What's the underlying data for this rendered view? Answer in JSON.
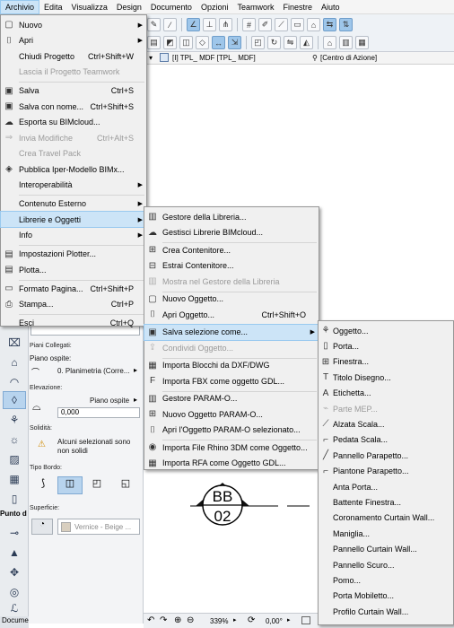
{
  "menubar": [
    "Archivio",
    "Edita",
    "Visualizza",
    "Design",
    "Documento",
    "Opzioni",
    "Teamwork",
    "Finestre",
    "Aiuto"
  ],
  "tabs": {
    "view": "[I] TPL_ MDF [TPL_ MDF]",
    "anchor": "[Centro di Azione]"
  },
  "file_menu": [
    {
      "label": "Nuovo",
      "shortcut": "",
      "submenu": true,
      "icon": "new-file-icon",
      "enabled": true
    },
    {
      "label": "Apri",
      "shortcut": "",
      "submenu": true,
      "icon": "open-folder-icon",
      "enabled": true
    },
    {
      "label": "Chiudi Progetto",
      "shortcut": "Ctrl+Shift+W",
      "submenu": false,
      "icon": "",
      "enabled": true
    },
    {
      "label": "Lascia il Progetto Teamwork",
      "shortcut": "",
      "submenu": false,
      "icon": "",
      "enabled": false
    },
    {
      "sep": true
    },
    {
      "label": "Salva",
      "shortcut": "Ctrl+S",
      "submenu": false,
      "icon": "save-icon",
      "enabled": true
    },
    {
      "label": "Salva con nome...",
      "shortcut": "Ctrl+Shift+S",
      "submenu": false,
      "icon": "save-as-icon",
      "enabled": true
    },
    {
      "label": "Esporta su BIMcloud...",
      "shortcut": "",
      "submenu": false,
      "icon": "cloud-export-icon",
      "enabled": true
    },
    {
      "label": "Invia Modifiche",
      "shortcut": "Ctrl+Alt+S",
      "submenu": false,
      "icon": "send-changes-icon",
      "enabled": false
    },
    {
      "label": "Crea Travel Pack",
      "shortcut": "",
      "submenu": false,
      "icon": "",
      "enabled": false
    },
    {
      "label": "Pubblica Iper-Modello BIMx...",
      "shortcut": "",
      "submenu": false,
      "icon": "bimx-icon",
      "enabled": true
    },
    {
      "label": "Interoperabilità",
      "shortcut": "",
      "submenu": true,
      "icon": "",
      "enabled": true
    },
    {
      "sep": true
    },
    {
      "label": "Contenuto Esterno",
      "shortcut": "",
      "submenu": true,
      "icon": "",
      "enabled": true
    },
    {
      "label": "Librerie e Oggetti",
      "shortcut": "",
      "submenu": true,
      "icon": "",
      "enabled": true,
      "active": true
    },
    {
      "label": "Info",
      "shortcut": "",
      "submenu": true,
      "icon": "",
      "enabled": true
    },
    {
      "sep": true
    },
    {
      "label": "Impostazioni Plotter...",
      "shortcut": "",
      "submenu": false,
      "icon": "plotter-setup-icon",
      "enabled": true
    },
    {
      "label": "Plotta...",
      "shortcut": "",
      "submenu": false,
      "icon": "plotter-icon",
      "enabled": true
    },
    {
      "sep": true
    },
    {
      "label": "Formato Pagina...",
      "shortcut": "Ctrl+Shift+P",
      "submenu": false,
      "icon": "page-setup-icon",
      "enabled": true
    },
    {
      "label": "Stampa...",
      "shortcut": "Ctrl+P",
      "submenu": false,
      "icon": "printer-icon",
      "enabled": true
    },
    {
      "sep": true
    },
    {
      "label": "Esci",
      "shortcut": "Ctrl+Q",
      "submenu": false,
      "icon": "",
      "enabled": true
    }
  ],
  "library_menu": [
    {
      "label": "Gestore della Libreria...",
      "shortcut": "",
      "icon": "library-manager-icon",
      "enabled": true
    },
    {
      "label": "Gestisci Librerie BIMcloud...",
      "shortcut": "",
      "icon": "bimcloud-library-icon",
      "enabled": true
    },
    {
      "sep": true
    },
    {
      "label": "Crea Contenitore...",
      "shortcut": "",
      "icon": "create-container-icon",
      "enabled": true
    },
    {
      "label": "Estrai Contenitore...",
      "shortcut": "",
      "icon": "extract-container-icon",
      "enabled": true
    },
    {
      "label": "Mostra nel Gestore della Libreria",
      "shortcut": "",
      "icon": "show-in-library-icon",
      "enabled": false
    },
    {
      "sep": true
    },
    {
      "label": "Nuovo Oggetto...",
      "shortcut": "",
      "icon": "new-object-icon",
      "enabled": true
    },
    {
      "label": "Apri Oggetto...",
      "shortcut": "Ctrl+Shift+O",
      "icon": "open-object-icon",
      "enabled": true
    },
    {
      "sep": true
    },
    {
      "label": "Salva selezione come...",
      "shortcut": "",
      "icon": "save-selection-icon",
      "enabled": true,
      "active": true,
      "submenu": true
    },
    {
      "label": "Condividi Oggetto...",
      "shortcut": "",
      "icon": "share-object-icon",
      "enabled": false
    },
    {
      "sep": true
    },
    {
      "label": "Importa Blocchi da DXF/DWG",
      "shortcut": "",
      "icon": "import-dxf-icon",
      "enabled": true
    },
    {
      "label": "Importa FBX come oggetto GDL...",
      "shortcut": "",
      "icon": "import-fbx-icon",
      "enabled": true
    },
    {
      "sep": true
    },
    {
      "label": "Gestore PARAM-O...",
      "shortcut": "",
      "icon": "param-o-manager-icon",
      "enabled": true
    },
    {
      "label": "Nuovo Oggetto PARAM-O...",
      "shortcut": "",
      "icon": "new-param-o-icon",
      "enabled": true
    },
    {
      "label": "Apri l'Oggetto PARAM-O selezionato...",
      "shortcut": "",
      "icon": "open-param-o-icon",
      "enabled": true
    },
    {
      "sep": true
    },
    {
      "label": "Importa File Rhino 3DM come Oggetto...",
      "shortcut": "",
      "icon": "import-rhino-icon",
      "enabled": true
    },
    {
      "label": "Importa RFA come Oggetto GDL...",
      "shortcut": "",
      "icon": "import-rfa-icon",
      "enabled": true
    }
  ],
  "save_as_menu": [
    {
      "label": "Oggetto...",
      "icon": "object-icon",
      "enabled": true
    },
    {
      "label": "Porta...",
      "icon": "door-icon",
      "enabled": true
    },
    {
      "label": "Finestra...",
      "icon": "window-icon",
      "enabled": true
    },
    {
      "label": "Titolo Disegno...",
      "icon": "drawing-title-icon",
      "enabled": true
    },
    {
      "label": "Etichetta...",
      "icon": "label-icon",
      "enabled": true
    },
    {
      "label": "Parte MEP...",
      "icon": "mep-part-icon",
      "enabled": false
    },
    {
      "label": "Alzata Scala...",
      "icon": "stair-riser-icon",
      "enabled": true
    },
    {
      "label": "Pedata Scala...",
      "icon": "stair-tread-icon",
      "enabled": true
    },
    {
      "label": "Pannello Parapetto...",
      "icon": "railing-panel-icon",
      "enabled": true
    },
    {
      "label": "Piantone Parapetto...",
      "icon": "railing-post-icon",
      "enabled": true
    },
    {
      "label": "Anta Porta...",
      "icon": "",
      "enabled": true
    },
    {
      "label": "Battente Finestra...",
      "icon": "",
      "enabled": true
    },
    {
      "label": "Coronamento Curtain Wall...",
      "icon": "",
      "enabled": true
    },
    {
      "label": "Maniglia...",
      "icon": "",
      "enabled": true
    },
    {
      "label": "Pannello Curtain Wall...",
      "icon": "",
      "enabled": true
    },
    {
      "label": "Pannello Scuro...",
      "icon": "",
      "enabled": true
    },
    {
      "label": "Pomo...",
      "icon": "",
      "enabled": true
    },
    {
      "label": "Porta Mobiletto...",
      "icon": "",
      "enabled": true
    },
    {
      "label": "Profilo Curtain Wall...",
      "icon": "",
      "enabled": true
    }
  ],
  "infobox": {
    "linked_stories": "Piani Collegati:",
    "home_story_label": "Piano ospite:",
    "home_story_value": "0. Planimetria (Corre...",
    "elevation_label": "Elevazione:",
    "elevation_ref": "Piano ospite",
    "elevation_value": "0,000",
    "solidity_label": "Solidità:",
    "solidity_text_1": "Alcuni selezionati sono",
    "solidity_text_2": "non solidi",
    "edge_type_label": "Tipo Bordo:",
    "surface_label": "Superficie:",
    "surface_value": "Vernice - Beige ...",
    "punto_label": "Punto d"
  },
  "drawing": {
    "marker_id": "BB",
    "marker_number": "02"
  },
  "statusbar": {
    "zoom": "339%",
    "angle": "0,00°"
  },
  "bottom_tab": "Docume"
}
